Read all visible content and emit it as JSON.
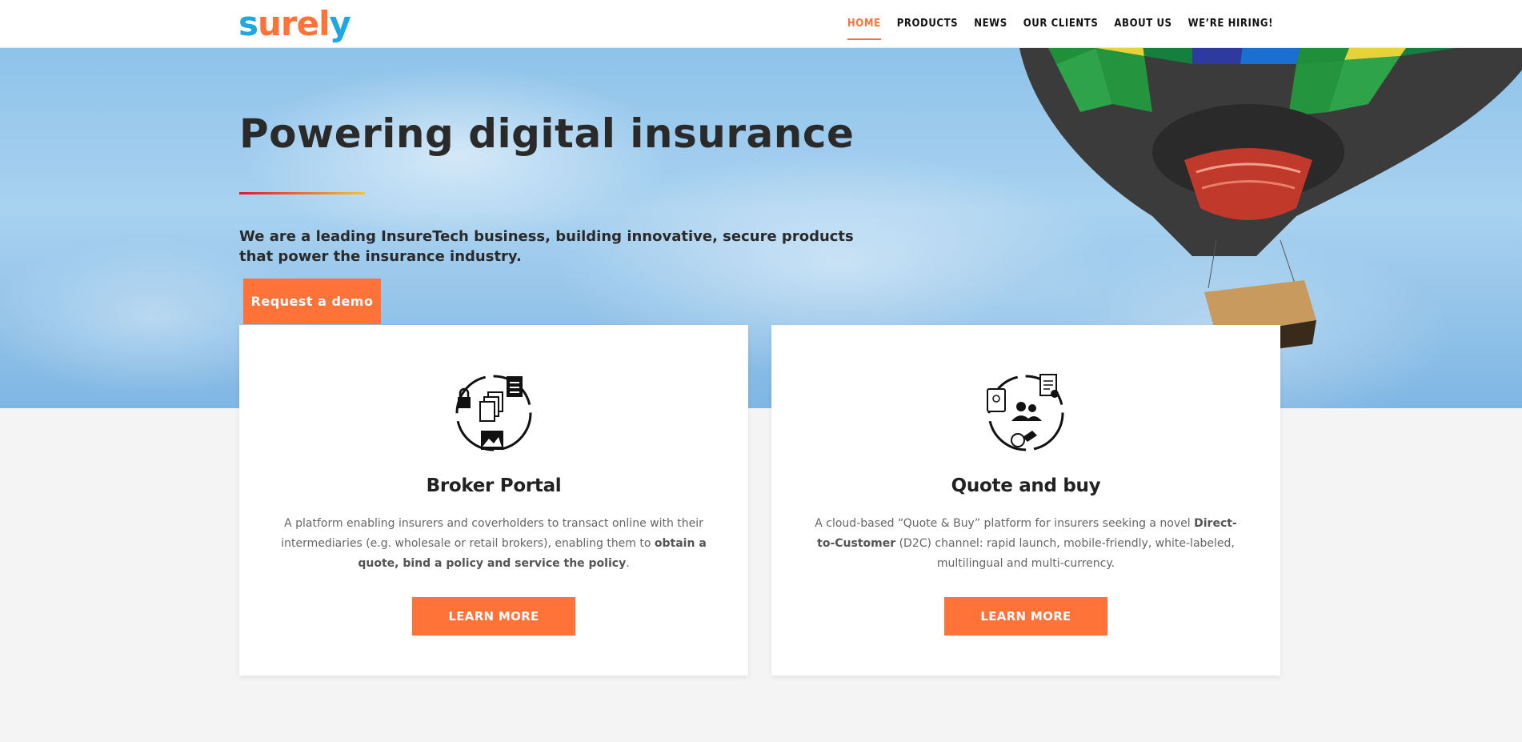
{
  "header": {
    "logo_part1": "s",
    "logo_part2": "urel",
    "logo_part3": "y",
    "nav": [
      {
        "label": "HOME",
        "active": true
      },
      {
        "label": "PRODUCTS"
      },
      {
        "label": "NEWS"
      },
      {
        "label": "OUR CLIENTS"
      },
      {
        "label": "ABOUT US"
      },
      {
        "label": "WE’RE HIRING!"
      }
    ]
  },
  "hero": {
    "title": "Powering digital insurance",
    "lead": "We are a leading InsureTech business, building innovative, secure products that power the insurance industry.",
    "cta": "Request a demo"
  },
  "cards": [
    {
      "title": "Broker Portal",
      "desc_1": "A platform enabling insurers and coverholders to transact online with their intermediaries (e.g. wholesale or retail brokers), enabling them to ",
      "desc_bold": "obtain a quote, bind a policy and service the policy",
      "desc_2": ".",
      "button": "LEARN MORE",
      "icon": "broker-portal-icon"
    },
    {
      "title": "Quote and buy",
      "desc_1": "A cloud-based “Quote & Buy” platform for insurers seeking a novel ",
      "desc_bold": "Direct-to-Customer",
      "desc_2": " (D2C) channel: rapid launch, mobile-friendly, white-labeled, multilingual and multi-currency.",
      "button": "LEARN MORE",
      "icon": "quote-and-buy-icon"
    }
  ],
  "colors": {
    "accent": "#ff7338",
    "logo_blue": "#1ea7e0",
    "title_text": "#2a2a2a"
  }
}
